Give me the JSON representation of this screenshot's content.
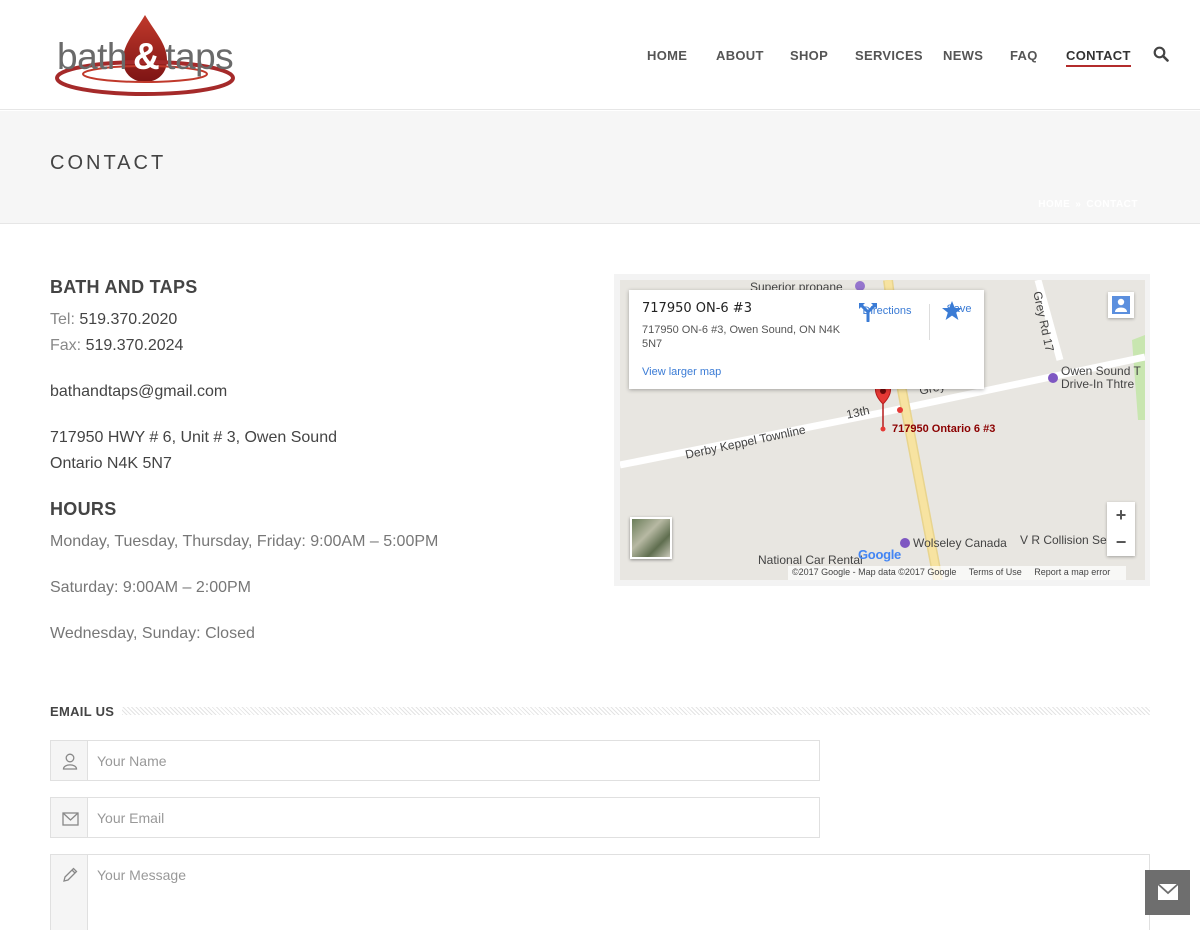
{
  "brand": {
    "logo_left": "bath",
    "logo_amp": "&",
    "logo_right": "taps"
  },
  "nav": {
    "items": [
      "HOME",
      "ABOUT",
      "SHOP",
      "SERVICES",
      "NEWS",
      "FAQ",
      "CONTACT"
    ],
    "active": "CONTACT",
    "search_icon": "search-icon"
  },
  "page": {
    "title": "CONTACT",
    "breadcrumb": [
      "HOME",
      "»",
      "CONTACT"
    ]
  },
  "contact": {
    "business_name": "BATH AND TAPS",
    "tel_label": "Tel:",
    "tel": "519.370.2020",
    "fax_label": "Fax:",
    "fax": "519.370.2024",
    "email": "bathandtaps@gmail.com",
    "address_line1": "717950 HWY # 6, Unit # 3, Owen Sound",
    "address_line2": "Ontario N4K 5N7"
  },
  "hours": {
    "title": "HOURS",
    "lines": [
      "Monday, Tuesday, Thursday, Friday: 9:00AM – 5:00PM",
      "Saturday: 9:00AM – 2:00PM",
      "Wednesday, Sunday: Closed"
    ]
  },
  "map": {
    "card_title": "717950 ON-6 #3",
    "card_address": "717950 ON-6 #3, Owen Sound, ON N4K 5N7",
    "directions_label": "Directions",
    "save_label": "Save",
    "view_larger": "View larger map",
    "pin_label": "717950 Ontario 6 #3",
    "labels": {
      "superior": "Superior propane",
      "grey_rd_17": "Grey Rd 17",
      "grey_rd": "Grey Rd",
      "thirteenth": "13th",
      "derby": "Derby Keppel Townline",
      "owen_sound_line1": "Owen Sound T",
      "owen_sound_line2": "Drive-In Thtre",
      "wolseley": "Wolseley Canada",
      "vr_collision": "V R Collision Se",
      "vr_collision_end": "es",
      "national": "National Car Rental"
    },
    "google": "Google",
    "footer": [
      "©2017 Google - Map data ©2017 Google",
      "Terms of Use",
      "Report a map error"
    ],
    "zoom_in": "+",
    "zoom_out": "−",
    "colors": {
      "road": "#ffffff",
      "highway": "#f7e3a1",
      "pin": "#e53935",
      "park": "#c8e6b0"
    }
  },
  "form": {
    "heading": "EMAIL US",
    "name_placeholder": "Your Name",
    "email_placeholder": "Your Email",
    "message_placeholder": "Your Message",
    "name_icon": "user-icon",
    "email_icon": "envelope-icon",
    "message_icon": "pencil-icon"
  },
  "floating": {
    "icon": "envelope-icon"
  },
  "colors": {
    "accent": "#b32c2c",
    "link": "#3a7bd5"
  }
}
